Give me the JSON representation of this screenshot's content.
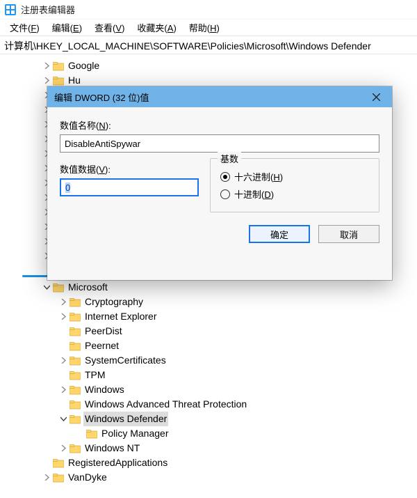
{
  "window": {
    "title": "注册表编辑器"
  },
  "menu": {
    "file": {
      "text": "文件",
      "key": "F"
    },
    "edit": {
      "text": "编辑",
      "key": "E"
    },
    "view": {
      "text": "查看",
      "key": "V"
    },
    "favorite": {
      "text": "收藏夹",
      "key": "A"
    },
    "help": {
      "text": "帮助",
      "key": "H"
    }
  },
  "address": {
    "path": "计算机\\HKEY_LOCAL_MACHINE\\SOFTWARE\\Policies\\Microsoft\\Windows Defender"
  },
  "dialog": {
    "title": "编辑 DWORD (32 位)值",
    "name_label": "数值名称(N):",
    "name_value": "DisableAntiSpywar",
    "data_label": "数值数据(V):",
    "data_value": "0",
    "base_label": "基数",
    "radio_hex": "十六进制(H)",
    "radio_dec": "十进制(D)",
    "ok": "确定",
    "cancel": "取消"
  },
  "tree": {
    "google": "Google",
    "huawei_partial": "Hu",
    "microsoft": "Microsoft",
    "cryptography": "Cryptography",
    "ie": "Internet Explorer",
    "peerdist": "PeerDist",
    "peernet": "Peernet",
    "syscerts": "SystemCertificates",
    "tpm": "TPM",
    "windows": "Windows",
    "watp": "Windows Advanced Threat Protection",
    "wdef": "Windows Defender",
    "polmgr": "Policy Manager",
    "winnt": "Windows NT",
    "regapps": "RegisteredApplications",
    "vandyke": "VanDyke"
  },
  "colors": {
    "title_accent": "#6fb3e8",
    "focus_blue": "#1a73e8"
  }
}
